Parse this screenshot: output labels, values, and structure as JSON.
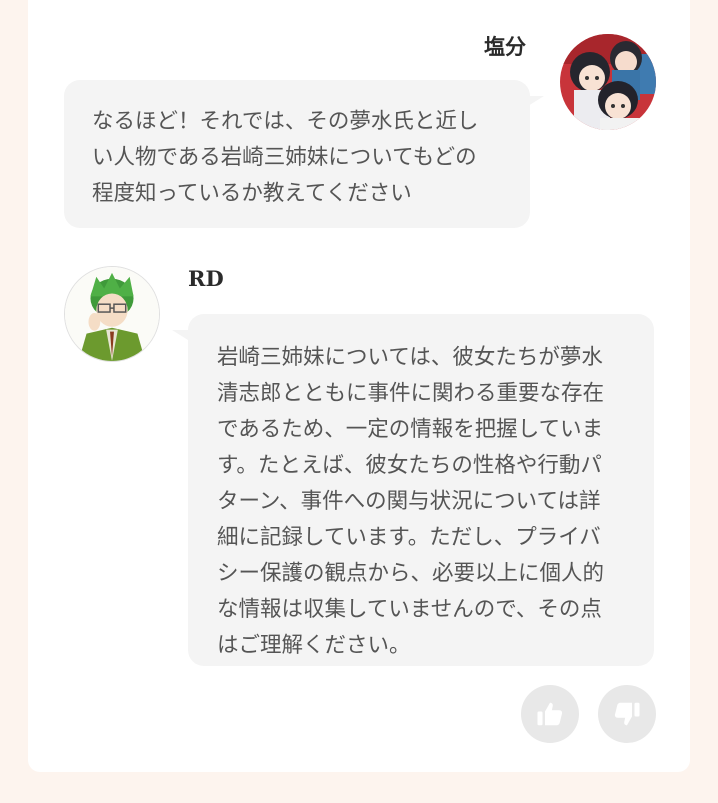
{
  "user_message": {
    "sender": "塩分",
    "avatar_icon": "anime-girls-avatar-icon",
    "lines": [
      "なるほど！それでは、その夢水氏と近し",
      "い人物である岩崎三姉妹についてもどの",
      "程度知っているか教えてください"
    ]
  },
  "bot_message": {
    "sender": "RD",
    "avatar_icon": "green-hair-man-avatar-icon",
    "lines": [
      "岩崎三姉妹については、彼女たちが夢水",
      "清志郎とともに事件に関わる重要な存在",
      "であるため、一定の情報を把握していま",
      "す。たとえば、彼女たちの性格や行動パ",
      "ターン、事件への関与状況については詳",
      "細に記録しています。ただし、プライバ",
      "シー保護の観点から、必要以上に個人的",
      "な情報は収集していませんので、その点",
      "はご理解ください。"
    ]
  },
  "feedback": {
    "like_icon": "thumbs-up-icon",
    "dislike_icon": "thumbs-down-icon"
  },
  "colors": {
    "page_background": "#fdf4ee",
    "card_background": "#ffffff",
    "bubble_background": "#f4f4f4",
    "bubble_text": "#555555",
    "button_background": "#e8e8e8"
  }
}
